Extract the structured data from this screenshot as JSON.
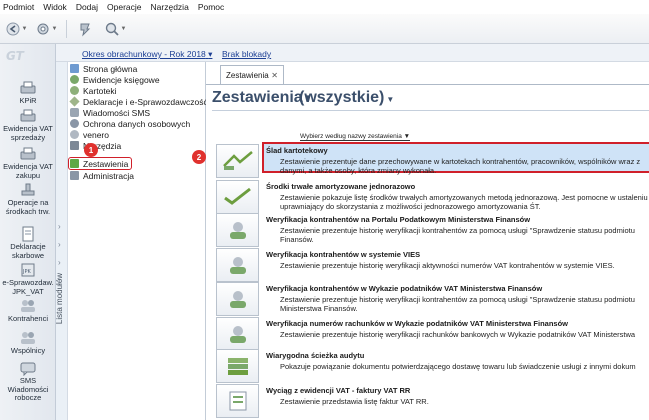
{
  "menu": [
    "Podmiot",
    "Widok",
    "Dodaj",
    "Operacje",
    "Narzędzia",
    "Pomoc"
  ],
  "toolbar_icons": [
    "back-arrow-icon",
    "gear-tools-icon",
    "refresh-icon",
    "search-icon"
  ],
  "period": {
    "label": "Okres obrachunkowy - Rok 2018",
    "locks": "Brak blokady"
  },
  "leftbar": [
    {
      "label": "KPiR",
      "icon": "printer-icon"
    },
    {
      "label": "Ewidencja VAT sprzedaży",
      "icon": "printer-icon"
    },
    {
      "label": "Ewidencja VAT zakupu",
      "icon": "printer-icon"
    },
    {
      "label": "Operacje na środkach trw.",
      "icon": "stamp-icon"
    },
    {
      "label": "Deklaracje skarbowe",
      "icon": "document-icon"
    },
    {
      "label": "e-Sprawozdaw. JPK_VAT",
      "icon": "jpk-icon"
    },
    {
      "label": "Kontrahenci",
      "icon": "people-icon"
    },
    {
      "label": "Wspólnicy",
      "icon": "people-icon"
    },
    {
      "label": "SMS Wiadomości robocze",
      "icon": "sms-icon"
    }
  ],
  "nav": {
    "vertical_label": "Lista modułów",
    "items": [
      {
        "label": "Strona główna",
        "icon": "home-icon"
      },
      {
        "label": "Ewidencje księgowe",
        "icon": "ledger-icon"
      },
      {
        "label": "Kartoteki",
        "icon": "folder-icon"
      },
      {
        "label": "Deklaracje i e-Sprawozdawczość",
        "icon": "declaration-icon"
      },
      {
        "label": "Wiadomości SMS",
        "icon": "sms-icon"
      },
      {
        "label": "Ochrona danych osobowych",
        "icon": "shield-icon"
      },
      {
        "label": "venero",
        "icon": "venero-icon"
      },
      {
        "label": "Narzędzia",
        "icon": "tools-icon"
      },
      {
        "label": "Zestawienia",
        "icon": "report-icon"
      },
      {
        "label": "Administracja",
        "icon": "admin-icon"
      }
    ],
    "badge1": "1",
    "badge2": "2"
  },
  "main": {
    "tab_label": "Zestawienia",
    "title": "Zestawienia",
    "filter": "(wszystkie)",
    "sub_selector": "Wybierz według nazwy zestawienia",
    "reports": [
      {
        "title": "Ślad kartotekowy",
        "desc": "Zestawienie prezentuje dane przechowywane w kartotekach kontrahentów, pracowników, wspólników wraz z danymi, a także osoby, która zmiany wykonała."
      },
      {
        "title": "Środki trwałe amortyzowane jednorazowo",
        "desc": "Zestawienie pokazuje listę środków trwałych amortyzowanych metodą jednorazową. Jest pomocne w ustaleniu uprawniający do skorzystania z możliwości jednorazowego amortyzowania ŚT."
      },
      {
        "title": "Weryfikacja kontrahentów na Portalu Podatkowym Ministerstwa Finansów",
        "desc": "Zestawienie prezentuje historię weryfikacji kontrahentów za pomocą usługi \"Sprawdzenie statusu podmiotu Finansów."
      },
      {
        "title": "Weryfikacja kontrahentów w systemie VIES",
        "desc": "Zestawienie prezentuje historię weryfikacji aktywności numerów VAT kontrahentów w systemie VIES."
      },
      {
        "title": "Weryfikacja kontrahentów w Wykazie podatników VAT Ministerstwa Finansów",
        "desc": "Zestawienie prezentuje historię weryfikacji kontrahentów za pomocą usługi \"Sprawdzenie statusu podmiotu Ministerstwa Finansów."
      },
      {
        "title": "Weryfikacja numerów rachunków w Wykazie podatników VAT Ministerstwa Finansów",
        "desc": "Zestawienie prezentuje historię weryfikacji rachunków bankowych w Wykazie podatników VAT Ministerstwa"
      },
      {
        "title": "Wiarygodna ścieżka audytu",
        "desc": "Pokazuje powiązanie dokumentu potwierdzającego dostawę towaru lub świadczenie usługi z innymi dokum"
      },
      {
        "title": "Wyciąg z ewidencji VAT - faktury VAT RR",
        "desc": "Zestawienie przedstawia listę faktur VAT RR."
      }
    ]
  },
  "colors": {
    "selection_fill": "#cfe3f7",
    "highlight_border": "#d0202a",
    "badge": "#e0312e",
    "title_text": "#3b4f6b",
    "link": "#1c3f94"
  }
}
